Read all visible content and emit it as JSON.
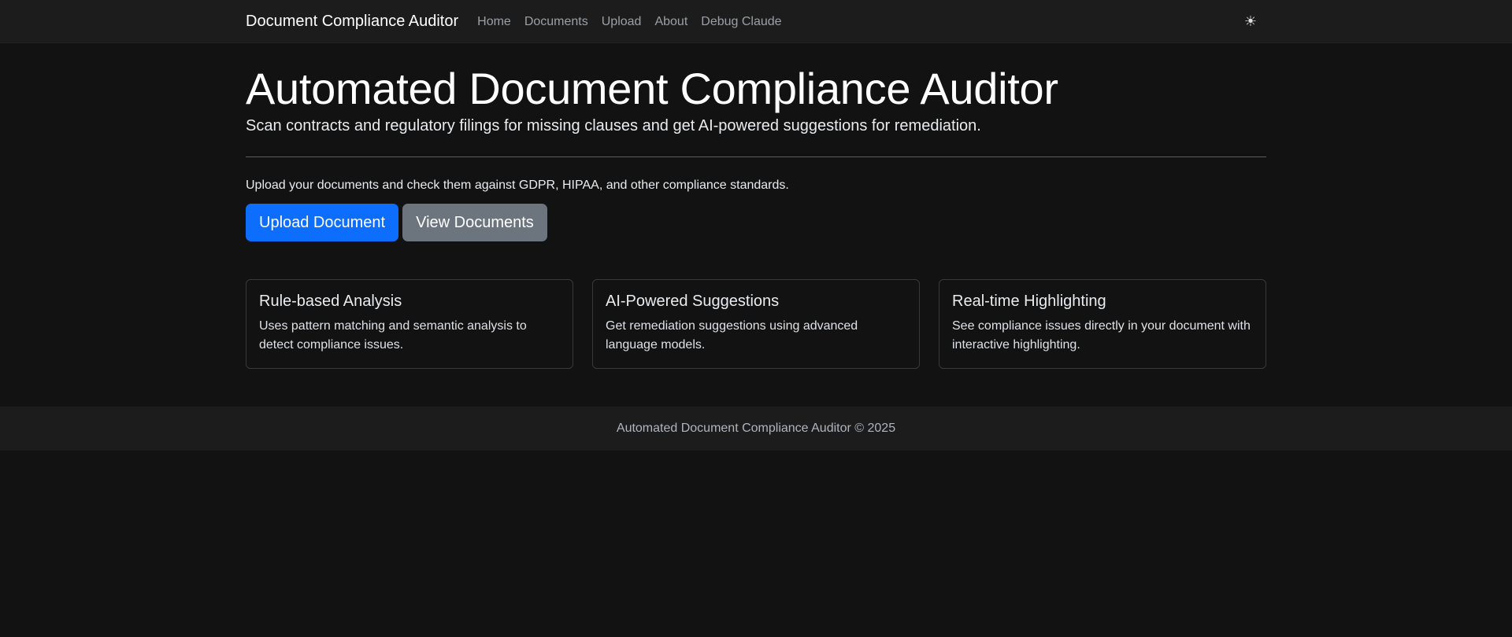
{
  "navbar": {
    "brand": "Document Compliance Auditor",
    "links": [
      {
        "label": "Home"
      },
      {
        "label": "Documents"
      },
      {
        "label": "Upload"
      },
      {
        "label": "About"
      },
      {
        "label": "Debug Claude"
      }
    ],
    "theme_toggle_icon": "☀"
  },
  "hero": {
    "title": "Automated Document Compliance Auditor",
    "lead": "Scan contracts and regulatory filings for missing clauses and get AI-powered suggestions for remediation.",
    "intro": "Upload your documents and check them against GDPR, HIPAA, and other compliance standards.",
    "upload_button": "Upload Document",
    "view_button": "View Documents"
  },
  "features": [
    {
      "title": "Rule-based Analysis",
      "text": "Uses pattern matching and semantic analysis to detect compliance issues."
    },
    {
      "title": "AI-Powered Suggestions",
      "text": "Get remediation suggestions using advanced language models."
    },
    {
      "title": "Real-time Highlighting",
      "text": "See compliance issues directly in your document with interactive highlighting."
    }
  ],
  "footer": {
    "text": "Automated Document Compliance Auditor © 2025"
  },
  "colors": {
    "background": "#121212",
    "navbar": "#1c1c1c",
    "primary": "#0d6efd",
    "secondary": "#6c757d"
  }
}
